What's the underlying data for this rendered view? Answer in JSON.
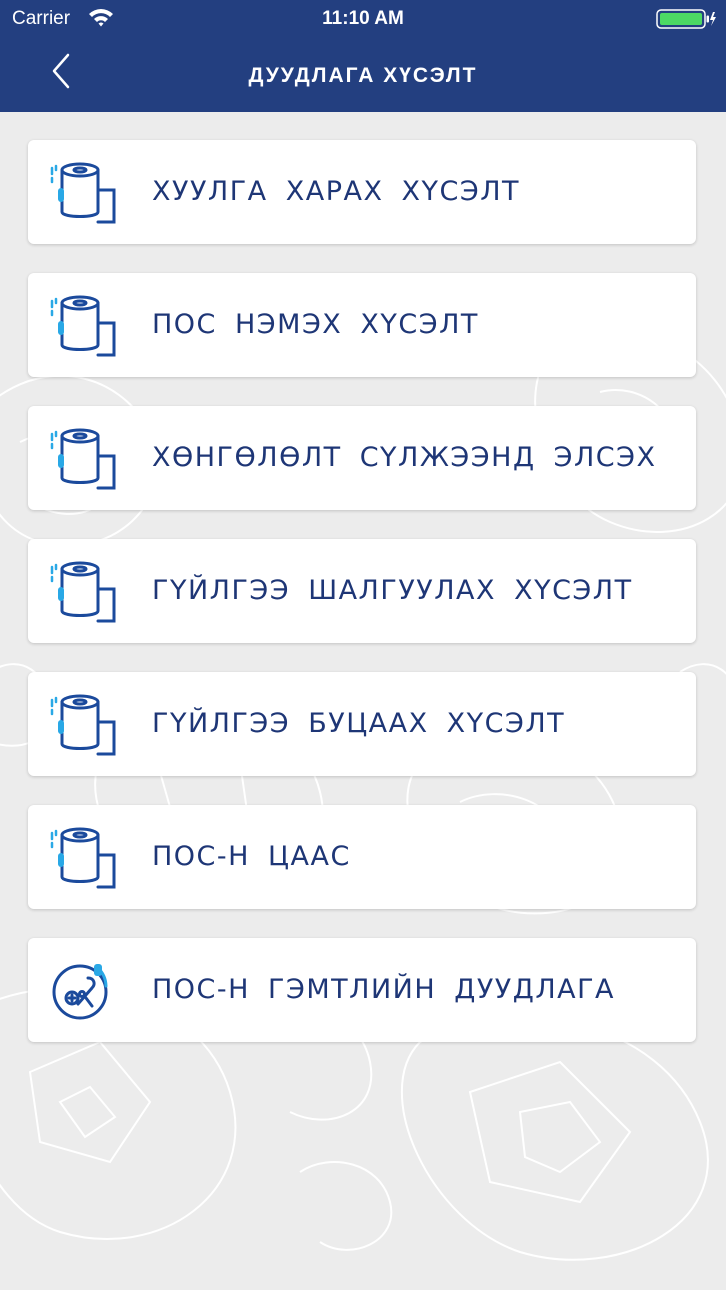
{
  "status_bar": {
    "carrier": "Carrier",
    "time": "11:10 AM",
    "wifi_icon": "wifi-icon",
    "battery_icon": "battery-icon"
  },
  "nav": {
    "title": "ДУУДЛАГА ХҮСЭЛТ",
    "back_icon": "chevron-left-icon"
  },
  "menu": {
    "items": [
      {
        "label": "ХУУЛГА ХАРАХ ХҮСЭЛТ",
        "icon": "paper-roll-icon"
      },
      {
        "label": "ПОС НЭМЭХ ХҮСЭЛТ",
        "icon": "paper-roll-icon"
      },
      {
        "label": "ХӨНГӨЛӨЛТ СҮЛЖЭЭНД ЭЛСЭХ",
        "icon": "paper-roll-icon"
      },
      {
        "label": "ГҮЙЛГЭЭ ШАЛГУУЛАХ ХҮСЭЛТ",
        "icon": "paper-roll-icon"
      },
      {
        "label": "ГҮЙЛГЭЭ БУЦААХ ХҮСЭЛТ",
        "icon": "paper-roll-icon"
      },
      {
        "label": "ПОС-Н ЦААС",
        "icon": "paper-roll-icon"
      },
      {
        "label": "ПОС-Н ГЭМТЛИЙН ДУУДЛАГА",
        "icon": "repair-tools-icon"
      }
    ]
  },
  "colors": {
    "header_bg": "#233f80",
    "page_bg": "#ececec",
    "label_text": "#1e3676",
    "icon_dark": "#1b4a9c",
    "icon_accent": "#29a8e6"
  }
}
